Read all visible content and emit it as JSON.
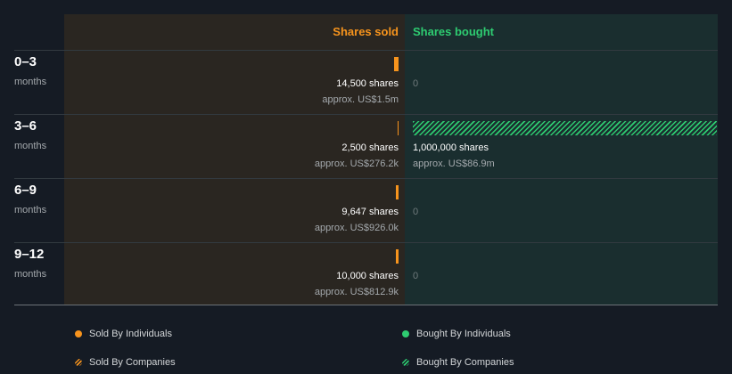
{
  "chart_data": {
    "type": "bar",
    "headers": {
      "sold": "Shares sold",
      "bought": "Shares bought"
    },
    "categories": [
      {
        "period": "0–3",
        "unit": "months"
      },
      {
        "period": "3–6",
        "unit": "months"
      },
      {
        "period": "6–9",
        "unit": "months"
      },
      {
        "period": "9–12",
        "unit": "months"
      }
    ],
    "series": [
      {
        "name": "Shares sold",
        "values": [
          14500,
          2500,
          9647,
          10000
        ],
        "labels": [
          "14,500 shares",
          "2,500 shares",
          "9,647 shares",
          "10,000 shares"
        ],
        "value_labels": [
          "approx. US$1.5m",
          "approx. US$276.2k",
          "approx. US$926.0k",
          "approx. US$812.9k"
        ]
      },
      {
        "name": "Shares bought",
        "values": [
          0,
          1000000,
          0,
          0
        ],
        "labels": [
          "0",
          "1,000,000 shares",
          "0",
          "0"
        ],
        "value_labels": [
          "",
          "approx. US$86.9m",
          "",
          ""
        ]
      }
    ],
    "legend": [
      {
        "label": "Sold By Individuals",
        "style": "dot",
        "color": "#f7941d"
      },
      {
        "label": "Bought By Individuals",
        "style": "dot",
        "color": "#2ecc71"
      },
      {
        "label": "Sold By Companies",
        "style": "hatch",
        "color": "#f7941d"
      },
      {
        "label": "Bought By Companies",
        "style": "hatch",
        "color": "#2ecc71"
      }
    ],
    "colors": {
      "sold": "#f7941d",
      "bought": "#2ecc71"
    }
  }
}
